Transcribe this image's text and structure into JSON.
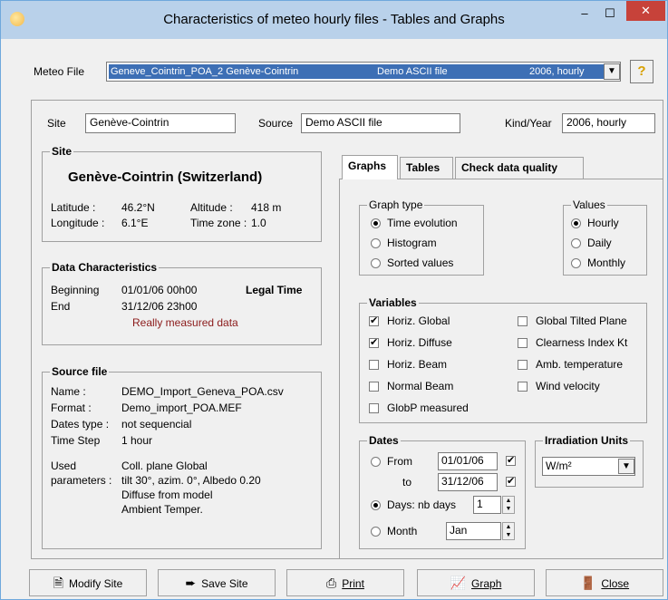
{
  "window": {
    "title": "Characteristics of meteo  hourly files  -  Tables and Graphs",
    "minimize": "–",
    "maximize": "☐",
    "close": "✕"
  },
  "meteo_file": {
    "label": "Meteo File",
    "selected_name": "Geneve_Cointrin_POA_2 Genève-Cointrin",
    "selected_source": "Demo ASCII file",
    "selected_period": "2006, hourly",
    "help": "?"
  },
  "site_row": {
    "site_label": "Site",
    "site_value": "Genève-Cointrin",
    "source_label": "Source",
    "source_value": "Demo ASCII file",
    "kind_label": "Kind/Year",
    "kind_value": "2006, hourly"
  },
  "site_group": {
    "title": "Site",
    "heading": "Genève-Cointrin  (Switzerland)",
    "latitude_label": "Latitude :",
    "latitude_value": "46.2°N",
    "longitude_label": "Longitude :",
    "longitude_value": "6.1°E",
    "altitude_label": "Altitude :",
    "altitude_value": "418 m",
    "timezone_label": "Time zone :",
    "timezone_value": "1.0"
  },
  "data_group": {
    "title": "Data Characteristics",
    "beginning_label": "Beginning",
    "beginning_value": "01/01/06 00h00",
    "end_label": "End",
    "end_value": "31/12/06 23h00",
    "legal_time": "Legal Time",
    "measured_note": "Really measured data"
  },
  "source_group": {
    "title": "Source file",
    "name_label": "Name :",
    "name_value": "DEMO_Import_Geneva_POA.csv",
    "format_label": "Format :",
    "format_value": "Demo_import_POA.MEF",
    "dates_label": "Dates type :",
    "dates_value": "not sequencial",
    "step_label": "Time Step",
    "step_value": "1 hour",
    "used_label": "Used",
    "params_label": "parameters :",
    "param_1": "Coll. plane Global",
    "param_2": "tilt 30°, azim. 0°, Albedo 0.20",
    "param_3": "Diffuse from model",
    "param_4": "Ambient Temper."
  },
  "tabs": [
    {
      "label": "Graphs"
    },
    {
      "label": "Tables"
    },
    {
      "label": "Check data quality"
    }
  ],
  "graph_type": {
    "title": "Graph type",
    "options": [
      "Time evolution",
      "Histogram",
      "Sorted values"
    ],
    "selected": "Time evolution"
  },
  "values_group": {
    "title": "Values",
    "options": [
      "Hourly",
      "Daily",
      "Monthly"
    ],
    "selected": "Hourly"
  },
  "variables": {
    "title": "Variables",
    "left": [
      {
        "label": "Horiz. Global",
        "checked": true
      },
      {
        "label": "Horiz. Diffuse",
        "checked": true
      },
      {
        "label": "Horiz. Beam",
        "checked": false
      },
      {
        "label": "Normal Beam",
        "checked": false
      },
      {
        "label": "GlobP measured",
        "checked": false
      }
    ],
    "right": [
      {
        "label": "Global Tilted Plane",
        "checked": false
      },
      {
        "label": "Clearness Index Kt",
        "checked": false
      },
      {
        "label": "Amb. temperature",
        "checked": false
      },
      {
        "label": "Wind velocity",
        "checked": false
      }
    ]
  },
  "dates": {
    "title": "Dates",
    "from_label": "From",
    "from_value": "01/01/06",
    "to_label": "to",
    "to_value": "31/12/06",
    "days_label": "Days: nb days",
    "days_value": "1",
    "month_label": "Month",
    "month_value": "Jan",
    "selected": "Days"
  },
  "irradiation": {
    "title": "Irradiation Units",
    "value": "W/m²"
  },
  "buttons": {
    "modify_site": "Modify Site",
    "save_site": "Save Site",
    "print": "Print",
    "graph": "Graph",
    "close": "Close"
  },
  "colors": {
    "selection": "#3d6fb5",
    "close_button": "#c7423a",
    "titlebar": "#b9d1ea",
    "measured_note": "#8b1a1a"
  }
}
